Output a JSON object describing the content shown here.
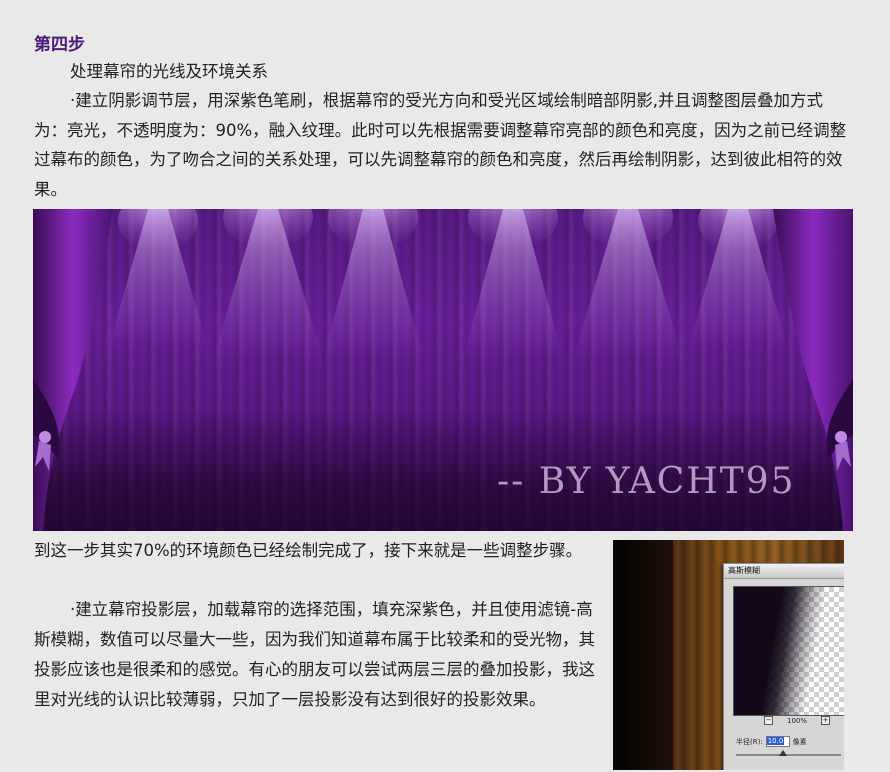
{
  "step": {
    "title": "第四步",
    "subtitle": "处理幕帘的光线及环境关系",
    "paragraph1": "·建立阴影调节层，用深紫色笔刷，根据幕帘的受光方向和受光区域绘制暗部阴影,并且调整图层叠加方式为：亮光，不透明度为：90%，融入纹理。此时可以先根据需要调整幕帘亮部的颜色和亮度，因为之前已经调整过幕布的颜色，为了吻合之间的关系处理，可以先调整幕帘的颜色和亮度，然后再绘制阴影，达到彼此相符的效果。"
  },
  "stage_image": {
    "watermark": "-- BY YACHT95",
    "colors": {
      "curtain": "#6b1f9c",
      "light": "#e6c8ff"
    }
  },
  "section2": {
    "paragraph1": "到这一步其实70%的环境颜色已经绘制完成了，接下来就是一些调整步骤。",
    "paragraph2": "·建立幕帘投影层，加载幕帘的选择范围，填充深紫色，并且使用滤镜-高斯模糊，数值可以尽量大一些，因为我们知道幕布属于比较柔和的受光物，其投影应该也是很柔和的感觉。有心的朋友可以尝试两层三层的叠加投影，我这里对光线的认识比较薄弱，只加了一层投影没有达到很好的投影效果。"
  },
  "dialog": {
    "title": "高斯模糊",
    "zoom_minus": "−",
    "zoom": "100%",
    "zoom_plus": "+",
    "radius_label": "半径(R):",
    "radius_value": "10.0",
    "radius_unit": "像素",
    "radius_slider_fraction": 0.45
  }
}
